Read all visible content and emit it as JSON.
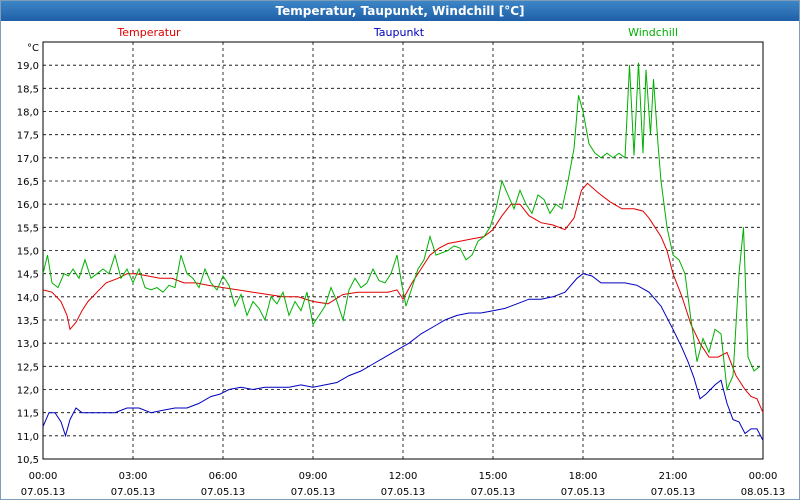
{
  "window": {
    "title": "Temperatur, Taupunkt, Windchill [°C]"
  },
  "chart_data": {
    "type": "line",
    "title": "Temperatur, Taupunkt, Windchill [°C]",
    "ylabel": "°C",
    "xlabel": "",
    "ylim": [
      10.5,
      19.5
    ],
    "xlim": [
      0,
      24
    ],
    "grid": true,
    "legend_position": "top",
    "y_ticks": [
      "10,5",
      "11,0",
      "11,5",
      "12,0",
      "12,5",
      "13,0",
      "13,5",
      "14,0",
      "14,5",
      "15,0",
      "15,5",
      "16,0",
      "16,5",
      "17,0",
      "17,5",
      "18,0",
      "18,5",
      "19,0"
    ],
    "x_ticks": [
      {
        "time": "00:00",
        "date": "07.05.13"
      },
      {
        "time": "03:00",
        "date": "07.05.13"
      },
      {
        "time": "06:00",
        "date": "07.05.13"
      },
      {
        "time": "09:00",
        "date": "07.05.13"
      },
      {
        "time": "12:00",
        "date": "07.05.13"
      },
      {
        "time": "15:00",
        "date": "07.05.13"
      },
      {
        "time": "18:00",
        "date": "07.05.13"
      },
      {
        "time": "21:00",
        "date": "07.05.13"
      },
      {
        "time": "00:00",
        "date": "08.05.13"
      }
    ],
    "series": [
      {
        "name": "Temperatur",
        "color": "#e00000",
        "points": [
          [
            0,
            14.15
          ],
          [
            0.3,
            14.1
          ],
          [
            0.6,
            13.9
          ],
          [
            0.8,
            13.6
          ],
          [
            0.9,
            13.3
          ],
          [
            1.1,
            13.45
          ],
          [
            1.3,
            13.7
          ],
          [
            1.5,
            13.9
          ],
          [
            1.8,
            14.1
          ],
          [
            2.1,
            14.3
          ],
          [
            2.5,
            14.4
          ],
          [
            2.8,
            14.5
          ],
          [
            3.1,
            14.5
          ],
          [
            3.5,
            14.45
          ],
          [
            3.9,
            14.4
          ],
          [
            4.3,
            14.4
          ],
          [
            4.7,
            14.3
          ],
          [
            5.1,
            14.3
          ],
          [
            5.5,
            14.25
          ],
          [
            6.0,
            14.2
          ],
          [
            6.5,
            14.15
          ],
          [
            7.0,
            14.1
          ],
          [
            7.5,
            14.05
          ],
          [
            8.0,
            14.0
          ],
          [
            8.5,
            14.0
          ],
          [
            9.0,
            13.9
          ],
          [
            9.5,
            13.85
          ],
          [
            10.0,
            14.05
          ],
          [
            10.5,
            14.1
          ],
          [
            11.0,
            14.1
          ],
          [
            11.5,
            14.1
          ],
          [
            11.8,
            14.15
          ],
          [
            12.0,
            13.95
          ],
          [
            12.3,
            14.3
          ],
          [
            12.6,
            14.6
          ],
          [
            12.9,
            14.9
          ],
          [
            13.2,
            15.05
          ],
          [
            13.5,
            15.15
          ],
          [
            13.9,
            15.2
          ],
          [
            14.3,
            15.25
          ],
          [
            14.7,
            15.3
          ],
          [
            15.0,
            15.45
          ],
          [
            15.3,
            15.75
          ],
          [
            15.6,
            16.0
          ],
          [
            15.9,
            16.0
          ],
          [
            16.2,
            15.75
          ],
          [
            16.6,
            15.6
          ],
          [
            17.0,
            15.55
          ],
          [
            17.4,
            15.45
          ],
          [
            17.7,
            15.7
          ],
          [
            17.95,
            16.3
          ],
          [
            18.15,
            16.45
          ],
          [
            18.5,
            16.25
          ],
          [
            18.9,
            16.05
          ],
          [
            19.3,
            15.9
          ],
          [
            19.7,
            15.9
          ],
          [
            20.0,
            15.85
          ],
          [
            20.2,
            15.7
          ],
          [
            20.4,
            15.5
          ],
          [
            20.6,
            15.3
          ],
          [
            20.8,
            15.0
          ],
          [
            21.0,
            14.5
          ],
          [
            21.3,
            14.0
          ],
          [
            21.6,
            13.4
          ],
          [
            21.9,
            13.0
          ],
          [
            22.2,
            12.7
          ],
          [
            22.5,
            12.7
          ],
          [
            22.8,
            12.8
          ],
          [
            23.1,
            12.3
          ],
          [
            23.4,
            12.0
          ],
          [
            23.6,
            11.85
          ],
          [
            23.8,
            11.8
          ],
          [
            24.0,
            11.5
          ]
        ]
      },
      {
        "name": "Taupunkt",
        "color": "#0000c0",
        "points": [
          [
            0,
            11.2
          ],
          [
            0.2,
            11.5
          ],
          [
            0.4,
            11.5
          ],
          [
            0.6,
            11.3
          ],
          [
            0.75,
            11.0
          ],
          [
            0.9,
            11.35
          ],
          [
            1.1,
            11.6
          ],
          [
            1.3,
            11.5
          ],
          [
            1.6,
            11.5
          ],
          [
            2.0,
            11.5
          ],
          [
            2.4,
            11.5
          ],
          [
            2.8,
            11.6
          ],
          [
            3.2,
            11.6
          ],
          [
            3.6,
            11.5
          ],
          [
            4.0,
            11.55
          ],
          [
            4.4,
            11.6
          ],
          [
            4.8,
            11.6
          ],
          [
            5.2,
            11.7
          ],
          [
            5.6,
            11.85
          ],
          [
            5.9,
            11.9
          ],
          [
            6.2,
            12.0
          ],
          [
            6.6,
            12.05
          ],
          [
            7.0,
            12.0
          ],
          [
            7.4,
            12.05
          ],
          [
            7.8,
            12.05
          ],
          [
            8.2,
            12.05
          ],
          [
            8.6,
            12.1
          ],
          [
            9.0,
            12.05
          ],
          [
            9.4,
            12.1
          ],
          [
            9.8,
            12.15
          ],
          [
            10.2,
            12.3
          ],
          [
            10.6,
            12.4
          ],
          [
            11.0,
            12.55
          ],
          [
            11.4,
            12.7
          ],
          [
            11.8,
            12.85
          ],
          [
            12.2,
            13.0
          ],
          [
            12.6,
            13.2
          ],
          [
            13.0,
            13.35
          ],
          [
            13.4,
            13.5
          ],
          [
            13.8,
            13.6
          ],
          [
            14.2,
            13.65
          ],
          [
            14.6,
            13.65
          ],
          [
            15.0,
            13.7
          ],
          [
            15.4,
            13.75
          ],
          [
            15.8,
            13.85
          ],
          [
            16.2,
            13.95
          ],
          [
            16.6,
            13.95
          ],
          [
            17.0,
            14.0
          ],
          [
            17.4,
            14.1
          ],
          [
            17.8,
            14.4
          ],
          [
            18.0,
            14.5
          ],
          [
            18.3,
            14.45
          ],
          [
            18.6,
            14.3
          ],
          [
            19.0,
            14.3
          ],
          [
            19.4,
            14.3
          ],
          [
            19.8,
            14.25
          ],
          [
            20.2,
            14.1
          ],
          [
            20.6,
            13.8
          ],
          [
            21.0,
            13.3
          ],
          [
            21.3,
            12.9
          ],
          [
            21.5,
            12.6
          ],
          [
            21.7,
            12.25
          ],
          [
            21.9,
            11.8
          ],
          [
            22.1,
            11.9
          ],
          [
            22.4,
            12.1
          ],
          [
            22.6,
            12.2
          ],
          [
            22.8,
            11.7
          ],
          [
            23.0,
            11.35
          ],
          [
            23.2,
            11.3
          ],
          [
            23.4,
            11.05
          ],
          [
            23.6,
            11.15
          ],
          [
            23.8,
            11.15
          ],
          [
            24.0,
            10.9
          ]
        ]
      },
      {
        "name": "Windchill",
        "color": "#00b000",
        "points": [
          [
            0,
            14.5
          ],
          [
            0.15,
            14.9
          ],
          [
            0.3,
            14.3
          ],
          [
            0.5,
            14.2
          ],
          [
            0.7,
            14.5
          ],
          [
            0.85,
            14.45
          ],
          [
            1.0,
            14.6
          ],
          [
            1.2,
            14.4
          ],
          [
            1.4,
            14.8
          ],
          [
            1.6,
            14.4
          ],
          [
            1.8,
            14.5
          ],
          [
            2.0,
            14.6
          ],
          [
            2.2,
            14.5
          ],
          [
            2.4,
            14.9
          ],
          [
            2.6,
            14.4
          ],
          [
            2.8,
            14.6
          ],
          [
            3.0,
            14.3
          ],
          [
            3.2,
            14.6
          ],
          [
            3.4,
            14.2
          ],
          [
            3.6,
            14.15
          ],
          [
            3.8,
            14.2
          ],
          [
            4.0,
            14.1
          ],
          [
            4.2,
            14.25
          ],
          [
            4.4,
            14.2
          ],
          [
            4.6,
            14.9
          ],
          [
            4.8,
            14.5
          ],
          [
            5.0,
            14.4
          ],
          [
            5.2,
            14.2
          ],
          [
            5.4,
            14.6
          ],
          [
            5.6,
            14.3
          ],
          [
            5.8,
            14.15
          ],
          [
            6.0,
            14.45
          ],
          [
            6.2,
            14.25
          ],
          [
            6.4,
            13.8
          ],
          [
            6.6,
            14.05
          ],
          [
            6.8,
            13.6
          ],
          [
            7.0,
            13.9
          ],
          [
            7.2,
            13.75
          ],
          [
            7.4,
            13.5
          ],
          [
            7.6,
            14.0
          ],
          [
            7.8,
            13.85
          ],
          [
            8.0,
            14.1
          ],
          [
            8.2,
            13.6
          ],
          [
            8.4,
            13.9
          ],
          [
            8.6,
            13.7
          ],
          [
            8.8,
            14.1
          ],
          [
            9.0,
            13.4
          ],
          [
            9.2,
            13.6
          ],
          [
            9.4,
            13.8
          ],
          [
            9.6,
            14.2
          ],
          [
            9.8,
            13.9
          ],
          [
            10.0,
            13.5
          ],
          [
            10.2,
            14.15
          ],
          [
            10.4,
            14.4
          ],
          [
            10.6,
            14.2
          ],
          [
            10.8,
            14.3
          ],
          [
            11.0,
            14.6
          ],
          [
            11.2,
            14.35
          ],
          [
            11.4,
            14.3
          ],
          [
            11.6,
            14.5
          ],
          [
            11.8,
            14.9
          ],
          [
            11.95,
            14.3
          ],
          [
            12.1,
            13.8
          ],
          [
            12.3,
            14.2
          ],
          [
            12.5,
            14.6
          ],
          [
            12.7,
            14.8
          ],
          [
            12.9,
            15.3
          ],
          [
            13.1,
            14.9
          ],
          [
            13.3,
            14.95
          ],
          [
            13.5,
            15.0
          ],
          [
            13.7,
            15.1
          ],
          [
            13.9,
            15.05
          ],
          [
            14.1,
            14.8
          ],
          [
            14.3,
            14.9
          ],
          [
            14.5,
            15.2
          ],
          [
            14.7,
            15.3
          ],
          [
            14.9,
            15.5
          ],
          [
            15.1,
            15.9
          ],
          [
            15.3,
            16.5
          ],
          [
            15.5,
            16.2
          ],
          [
            15.7,
            15.9
          ],
          [
            15.9,
            16.3
          ],
          [
            16.1,
            16.0
          ],
          [
            16.3,
            15.8
          ],
          [
            16.5,
            16.2
          ],
          [
            16.7,
            16.1
          ],
          [
            16.9,
            15.8
          ],
          [
            17.1,
            16.0
          ],
          [
            17.3,
            15.9
          ],
          [
            17.5,
            16.5
          ],
          [
            17.7,
            17.2
          ],
          [
            17.85,
            18.35
          ],
          [
            18.0,
            18.0
          ],
          [
            18.2,
            17.3
          ],
          [
            18.4,
            17.1
          ],
          [
            18.6,
            17.0
          ],
          [
            18.8,
            17.1
          ],
          [
            19.0,
            17.0
          ],
          [
            19.2,
            17.1
          ],
          [
            19.4,
            17.0
          ],
          [
            19.55,
            19.0
          ],
          [
            19.7,
            17.05
          ],
          [
            19.85,
            19.05
          ],
          [
            20.0,
            17.1
          ],
          [
            20.1,
            18.9
          ],
          [
            20.25,
            17.5
          ],
          [
            20.35,
            18.7
          ],
          [
            20.5,
            17.3
          ],
          [
            20.6,
            16.5
          ],
          [
            20.8,
            15.5
          ],
          [
            21.0,
            14.9
          ],
          [
            21.2,
            14.8
          ],
          [
            21.4,
            14.5
          ],
          [
            21.6,
            13.5
          ],
          [
            21.8,
            12.6
          ],
          [
            22.0,
            13.1
          ],
          [
            22.2,
            12.8
          ],
          [
            22.4,
            13.3
          ],
          [
            22.6,
            13.2
          ],
          [
            22.8,
            12.0
          ],
          [
            23.0,
            12.3
          ],
          [
            23.2,
            14.5
          ],
          [
            23.35,
            15.5
          ],
          [
            23.5,
            12.7
          ],
          [
            23.7,
            12.4
          ],
          [
            23.9,
            12.5
          ]
        ]
      }
    ]
  }
}
